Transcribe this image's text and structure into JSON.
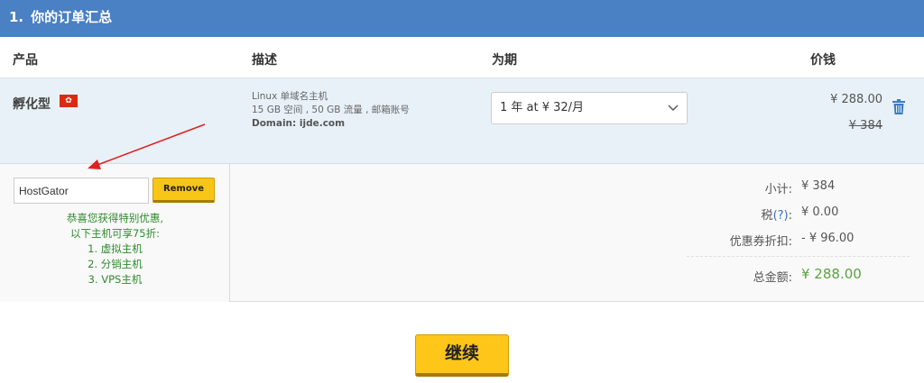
{
  "header": {
    "number": "1.",
    "title": "你的订单汇总"
  },
  "columns": {
    "product": "产品",
    "description": "描述",
    "period": "为期",
    "price": "价钱"
  },
  "item": {
    "name": "孵化型",
    "flag_glyph": "✿",
    "desc_line1": "Linux 单域名主机",
    "desc_line2": "15 GB 空间 , 50 GB 流量 , 邮箱账号",
    "desc_domain": "Domain: ijde.com",
    "period_selected": "1 年 at ¥ 32/月",
    "price": "¥ 288.00",
    "price_original": "¥ 384",
    "delete_icon": "trash-icon"
  },
  "promo": {
    "code_value": "HostGator",
    "remove_label": "Remove",
    "message_lines": [
      "恭喜您获得特别优惠,",
      "以下主机可享75折:",
      "1. 虚拟主机",
      "2. 分销主机",
      "3. VPS主机"
    ]
  },
  "totals": {
    "subtotal_label": "小计:",
    "subtotal_value": "¥ 384",
    "tax_label_prefix": "税",
    "tax_help": "(?)",
    "tax_label_suffix": ":",
    "tax_value": "¥ 0.00",
    "discount_label": "优惠券折扣:",
    "discount_value": "- ¥ 96.00",
    "total_label": "总金额:",
    "total_value": "¥ 288.00"
  },
  "actions": {
    "continue_label": "继续"
  },
  "colors": {
    "header_bg": "#4a80c4",
    "row_bg": "#e8f1f8",
    "button_yellow": "#ffc61a",
    "total_green": "#5aa343",
    "annotation_red": "#e02020"
  }
}
